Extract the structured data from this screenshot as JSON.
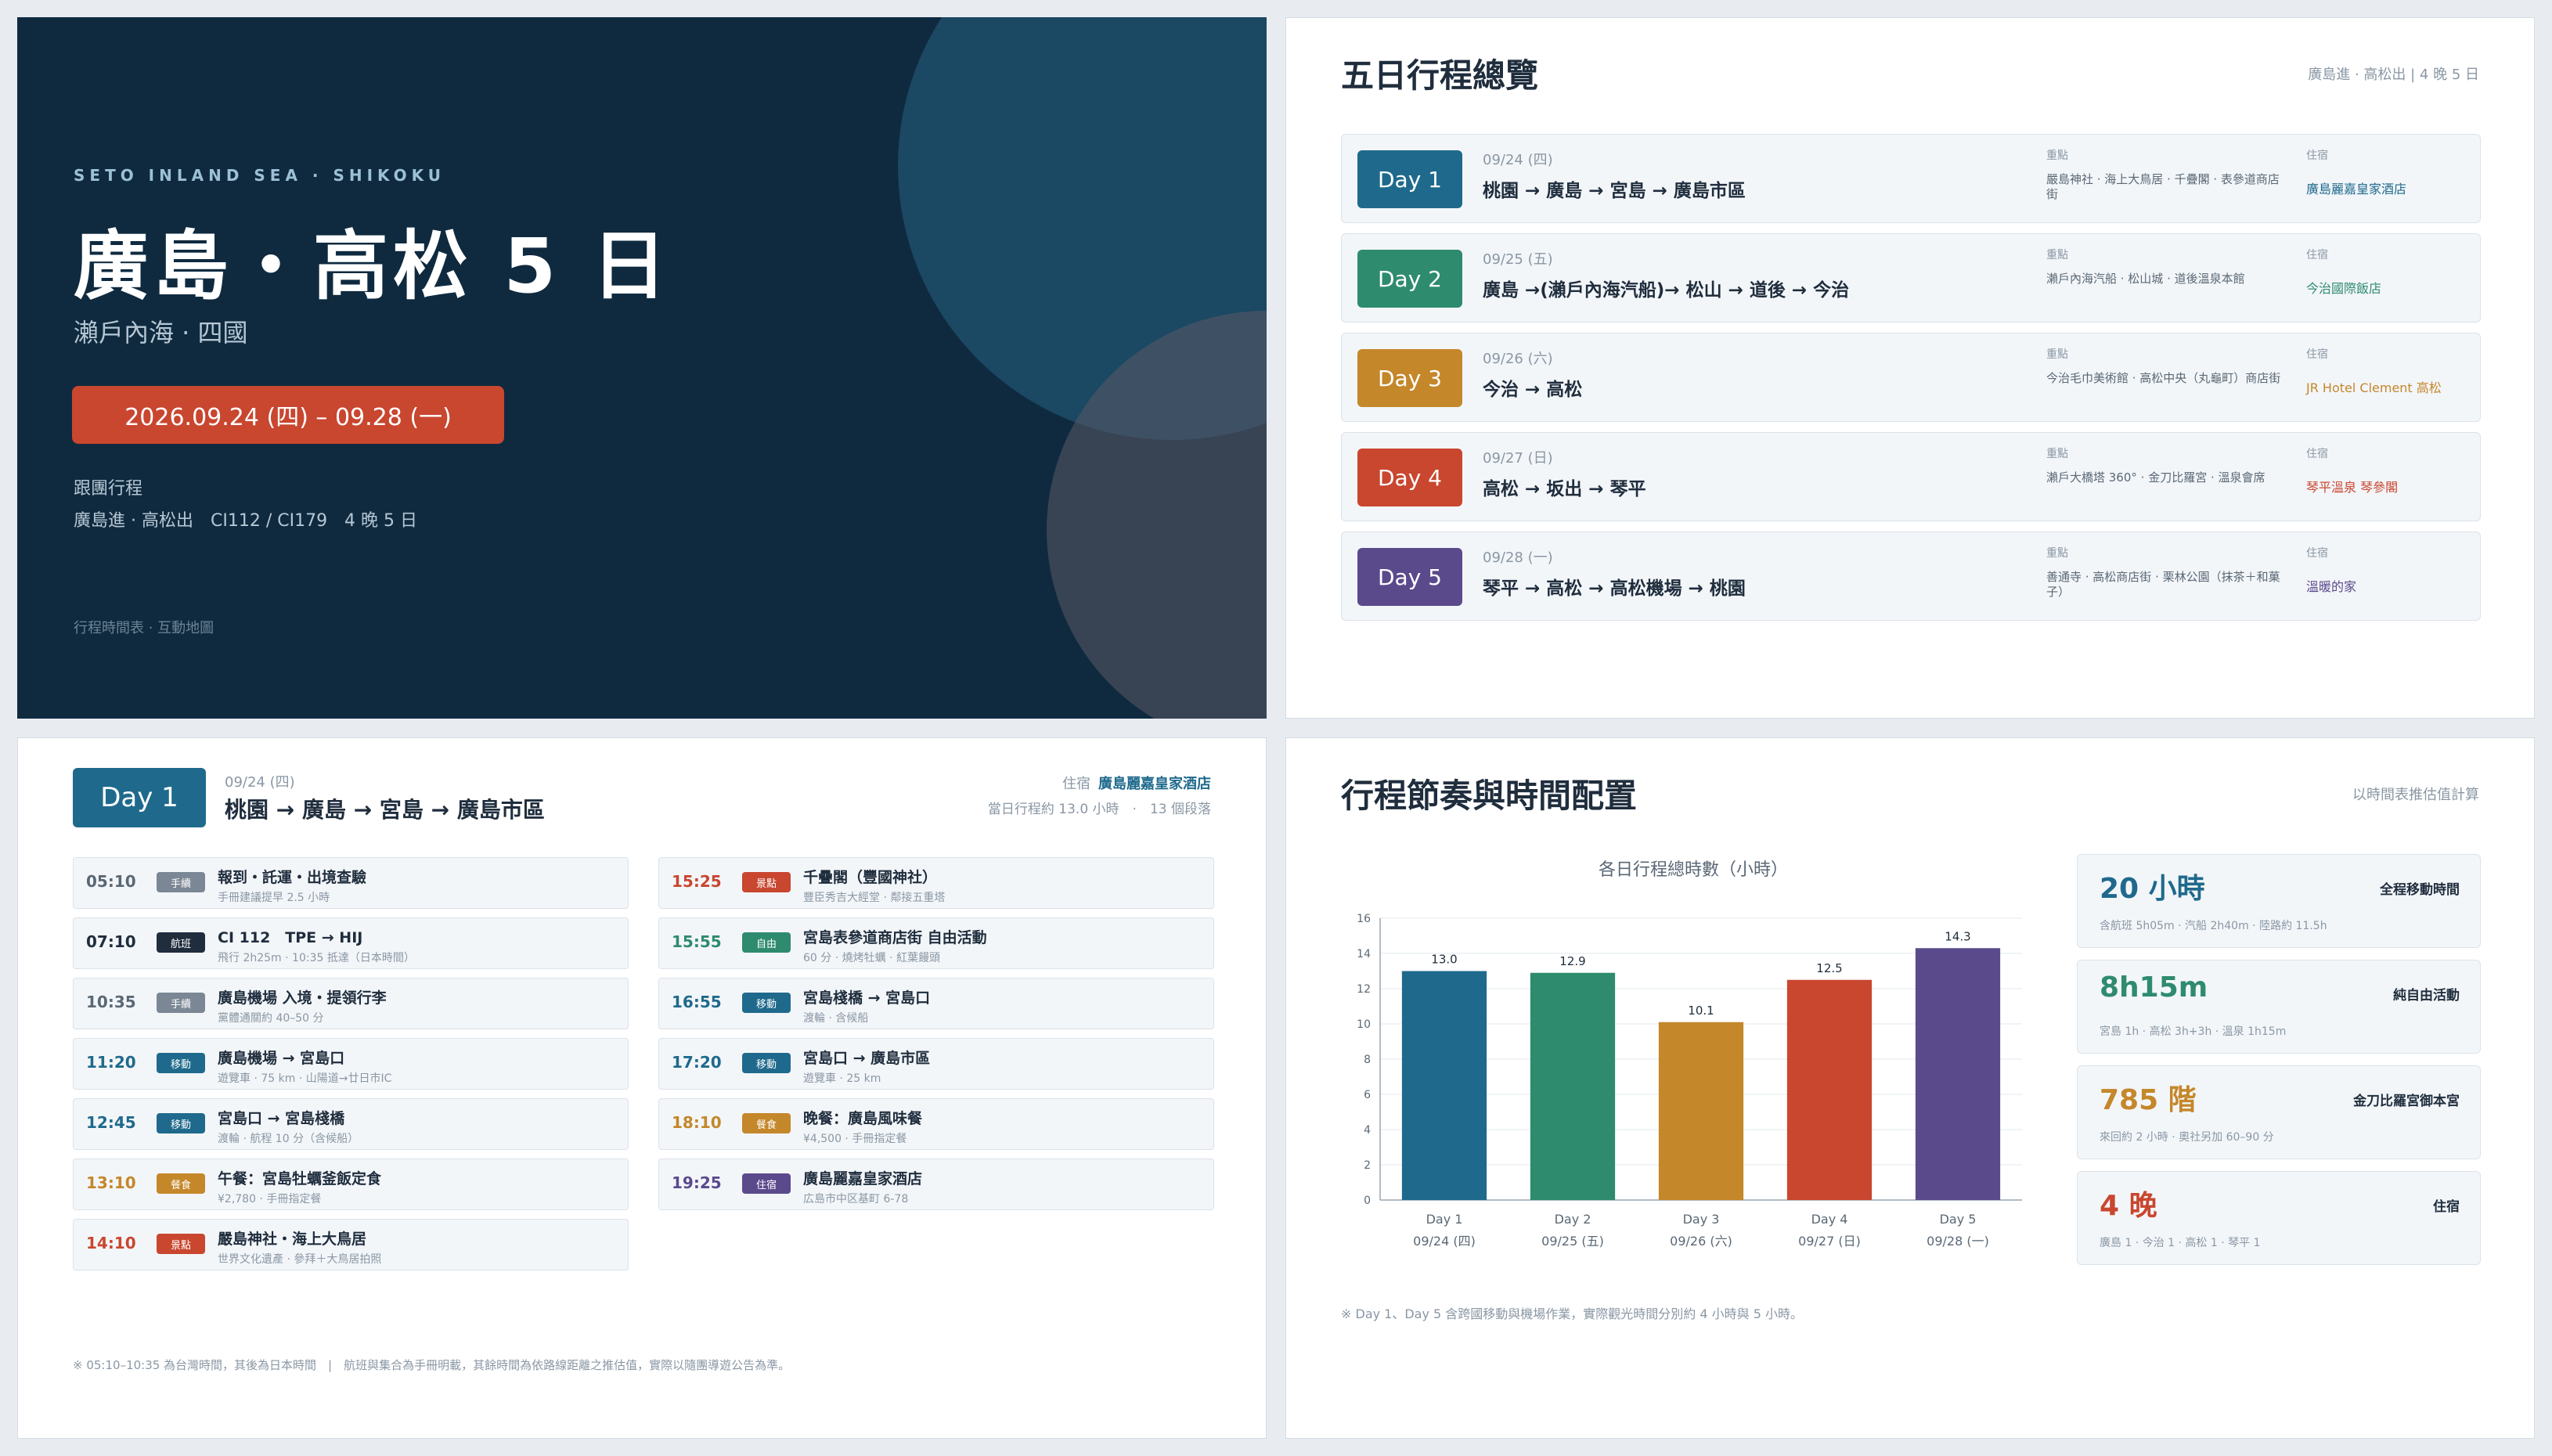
{
  "cover": {
    "eyebrow": "SETO INLAND SEA · SHIKOKU",
    "title": "廣島・高松 5 日",
    "subtitle": "瀨戶內海 · 四國",
    "date_range": "2026.09.24 (四) – 09.28 (一)",
    "tour_type": "跟團行程",
    "detail": "廣島進 · 高松出　CI112 / CI179　4 晚 5 日",
    "footer": "行程時間表 · 互動地圖"
  },
  "overview": {
    "title": "五日行程總覽",
    "note": "廣島進 · 高松出 | 4 晚 5 日",
    "highlight_label": "重點",
    "stay_label": "住宿",
    "days": [
      {
        "badge": "Day 1",
        "date": "09/24 (四)",
        "route": "桃園 → 廣島 → 宮島 → 廣島市區",
        "highlights": "嚴島神社 · 海上大鳥居 · 千疊閣 · 表參道商店街",
        "stay": "廣島麗嘉皇家酒店",
        "color": "#1f6a8c"
      },
      {
        "badge": "Day 2",
        "date": "09/25 (五)",
        "route": "廣島 →(瀨戶內海汽船)→ 松山 → 道後 → 今治",
        "highlights": "瀨戶內海汽船 · 松山城 · 道後溫泉本館",
        "stay": "今治國際飯店",
        "color": "#2e8b6e"
      },
      {
        "badge": "Day 3",
        "date": "09/26 (六)",
        "route": "今治 → 高松",
        "highlights": "今治毛巾美術館 · 高松中央（丸龜町）商店街",
        "stay": "JR Hotel Clement 高松",
        "color": "#c4872a"
      },
      {
        "badge": "Day 4",
        "date": "09/27 (日)",
        "route": "高松 → 坂出 → 琴平",
        "highlights": "瀨戶大橋塔 360° · 金刀比羅宮 · 溫泉會席",
        "stay": "琴平溫泉 琴參閣",
        "color": "#c9462f"
      },
      {
        "badge": "Day 5",
        "date": "09/28 (一)",
        "route": "琴平 → 高松 → 高松機場 → 桃園",
        "highlights": "善通寺 · 高松商店街 · 栗林公園（抹茶＋和菓子）",
        "stay": "溫暖的家",
        "color": "#5a4a8c"
      }
    ]
  },
  "day1": {
    "badge": "Day 1",
    "date": "09/24 (四)",
    "route": "桃園 → 廣島 → 宮島 → 廣島市區",
    "stay_label": "住宿",
    "stay": "廣島麗嘉皇家酒店",
    "meta": "當日行程約 13.0 小時　·　13 個段落",
    "footer": "※ 05:10–10:35 為台灣時間，其後為日本時間　|　航班與集合為手冊明載，其餘時間為依路線距離之推估值，實際以隨團導遊公告為準。",
    "events_left": [
      {
        "time": "05:10",
        "tag": "手續",
        "title": "報到・託運・出境查驗",
        "sub": "手冊建議提早 2.5 小時",
        "tcolor": "#5a6875",
        "gcolor": "#7b8794"
      },
      {
        "time": "07:10",
        "tag": "航班",
        "title": "CI 112　TPE → HIJ",
        "sub": "飛行 2h25m · 10:35 抵達（日本時間）",
        "tcolor": "#1f2d3d",
        "gcolor": "#1f2d3d"
      },
      {
        "time": "10:35",
        "tag": "手續",
        "title": "廣島機場 入境・提領行李",
        "sub": "黨體通關約 40–50 分",
        "tcolor": "#5a6875",
        "gcolor": "#7b8794"
      },
      {
        "time": "11:20",
        "tag": "移動",
        "title": "廣島機場 → 宮島口",
        "sub": "遊覽車 · 75 km · 山陽道→廿日市IC",
        "tcolor": "#1f6a8c",
        "gcolor": "#1f6a8c"
      },
      {
        "time": "12:45",
        "tag": "移動",
        "title": "宮島口 → 宮島棧橋",
        "sub": "渡輪 · 航程 10 分（含候船）",
        "tcolor": "#1f6a8c",
        "gcolor": "#1f6a8c"
      },
      {
        "time": "13:10",
        "tag": "餐食",
        "title": "午餐：宮島牡蠣釜飯定食",
        "sub": "¥2,780 · 手冊指定餐",
        "tcolor": "#c4872a",
        "gcolor": "#c4872a"
      },
      {
        "time": "14:10",
        "tag": "景點",
        "title": "嚴島神社・海上大鳥居",
        "sub": "世界文化遺產 · 參拜＋大鳥居拍照",
        "tcolor": "#c9462f",
        "gcolor": "#c9462f"
      }
    ],
    "events_right": [
      {
        "time": "15:25",
        "tag": "景點",
        "title": "千疊閣（豐國神社）",
        "sub": "豐臣秀吉大經堂 · 鄰接五重塔",
        "tcolor": "#c9462f",
        "gcolor": "#c9462f"
      },
      {
        "time": "15:55",
        "tag": "自由",
        "title": "宮島表參道商店街 自由活動",
        "sub": "60 分 · 燒烤牡蠣 · 紅葉饅頭",
        "tcolor": "#2e8b6e",
        "gcolor": "#2e8b6e"
      },
      {
        "time": "16:55",
        "tag": "移動",
        "title": "宮島棧橋 → 宮島口",
        "sub": "渡輪 · 含候船",
        "tcolor": "#1f6a8c",
        "gcolor": "#1f6a8c"
      },
      {
        "time": "17:20",
        "tag": "移動",
        "title": "宮島口 → 廣島市區",
        "sub": "遊覽車 · 25 km",
        "tcolor": "#1f6a8c",
        "gcolor": "#1f6a8c"
      },
      {
        "time": "18:10",
        "tag": "餐食",
        "title": "晚餐：廣島風味餐",
        "sub": "¥4,500 · 手冊指定餐",
        "tcolor": "#c4872a",
        "gcolor": "#c4872a"
      },
      {
        "time": "19:25",
        "tag": "住宿",
        "title": "廣島麗嘉皇家酒店",
        "sub": "広島市中区基町 6-78",
        "tcolor": "#5a4a8c",
        "gcolor": "#5a4a8c"
      }
    ]
  },
  "pace": {
    "title": "行程節奏與時間配置",
    "note": "以時間表推估值計算",
    "footnote": "※ Day 1、Day 5 含跨國移動與機場作業，實際觀光時間分別約 4 小時與 5 小時。",
    "stats": [
      {
        "value": "20 小時",
        "label": "全程移動時間",
        "sub": "含航班 5h05m · 汽船 2h40m · 陸路約 11.5h",
        "color": "#1f6a8c"
      },
      {
        "value": "8h15m",
        "label": "純自由活動",
        "sub": "宮島 1h · 高松 3h+3h · 溫泉 1h15m",
        "color": "#2e8b6e"
      },
      {
        "value": "785 階",
        "label": "金刀比羅宮御本宮",
        "sub": "來回約 2 小時 · 奧社另加 60–90 分",
        "color": "#c4872a"
      },
      {
        "value": "4 晚",
        "label": "住宿",
        "sub": "廣島 1 · 今治 1 · 高松 1 · 琴平 1",
        "color": "#c9462f"
      }
    ]
  },
  "chart_data": {
    "type": "bar",
    "title": "各日行程總時數（小時）",
    "categories": [
      "Day 1",
      "Day 2",
      "Day 3",
      "Day 4",
      "Day 5"
    ],
    "sublabels": [
      "09/24 (四)",
      "09/25 (五)",
      "09/26 (六)",
      "09/27 (日)",
      "09/28 (一)"
    ],
    "values": [
      13.0,
      12.9,
      10.1,
      12.5,
      14.3
    ],
    "value_labels": [
      "13.0",
      "12.9",
      "10.1",
      "12.5",
      "14.3"
    ],
    "colors": [
      "#1f6a8c",
      "#2e8b6e",
      "#c4872a",
      "#c9462f",
      "#5a4a8c"
    ],
    "ylim": [
      0,
      16
    ],
    "yticks": [
      "0",
      "2",
      "4",
      "6",
      "8",
      "10",
      "12",
      "14",
      "16"
    ],
    "grid": true,
    "legend": "none"
  }
}
